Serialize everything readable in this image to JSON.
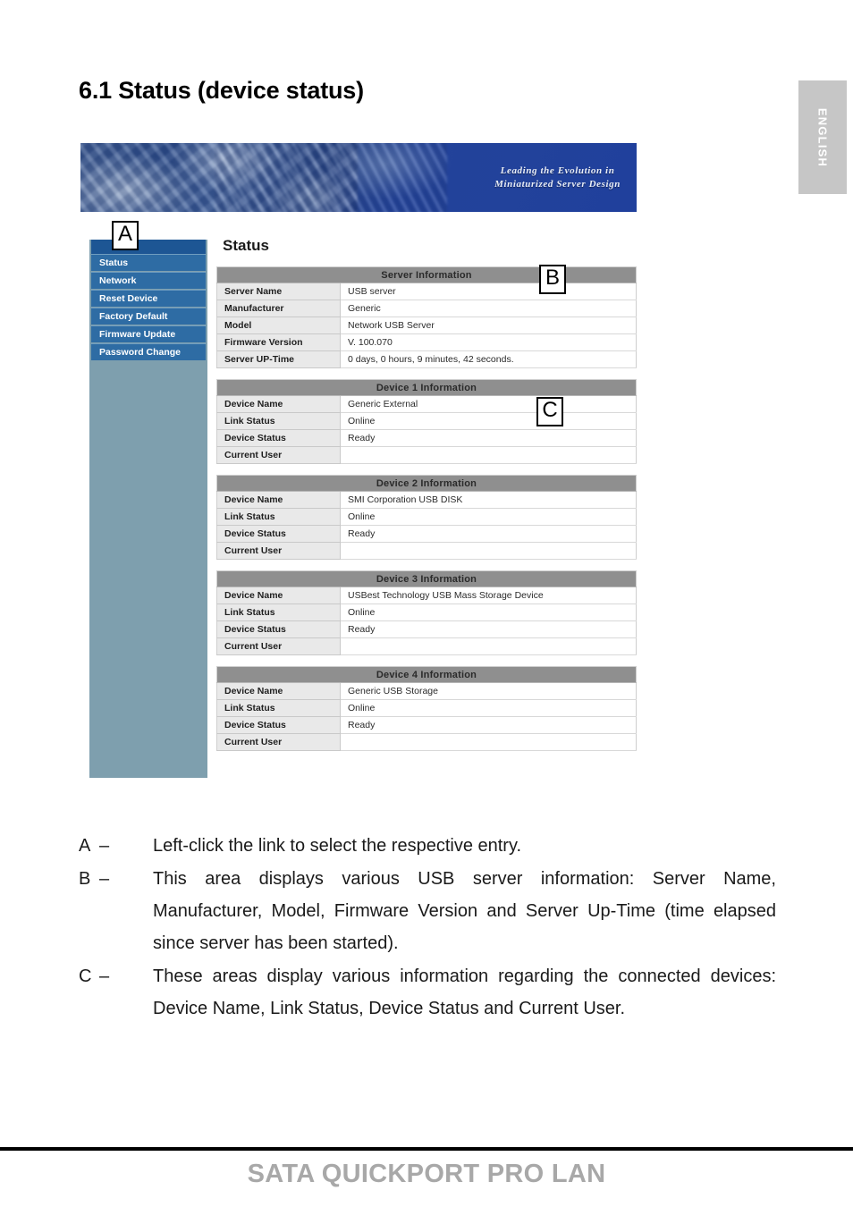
{
  "page": {
    "heading": "6.1 Status (device status)",
    "language_tab": "ENGLISH",
    "footer_title": "SATA QUICKPORT PRO LAN"
  },
  "screenshot": {
    "banner": {
      "tagline_line1": "Leading the Evolution in",
      "tagline_line2": "Miniaturized Server Design"
    },
    "sidebar": {
      "items": [
        {
          "label": "Status"
        },
        {
          "label": "Network"
        },
        {
          "label": "Reset Device"
        },
        {
          "label": "Factory Default"
        },
        {
          "label": "Firmware Update"
        },
        {
          "label": "Password Change"
        }
      ]
    },
    "content": {
      "title": "Status",
      "tables": [
        {
          "header": "Server Information",
          "rows": [
            {
              "label": "Server Name",
              "value": "USB server"
            },
            {
              "label": "Manufacturer",
              "value": "Generic"
            },
            {
              "label": "Model",
              "value": "Network USB Server"
            },
            {
              "label": "Firmware Version",
              "value": "V. 100.070"
            },
            {
              "label": "Server UP-Time",
              "value": "0 days, 0 hours, 9 minutes, 42 seconds."
            }
          ]
        },
        {
          "header": "Device 1 Information",
          "rows": [
            {
              "label": "Device Name",
              "value": "Generic External"
            },
            {
              "label": "Link Status",
              "value": "Online"
            },
            {
              "label": "Device Status",
              "value": "Ready"
            },
            {
              "label": "Current User",
              "value": ""
            }
          ]
        },
        {
          "header": "Device 2 Information",
          "rows": [
            {
              "label": "Device Name",
              "value": "SMI Corporation USB DISK"
            },
            {
              "label": "Link Status",
              "value": "Online"
            },
            {
              "label": "Device Status",
              "value": "Ready"
            },
            {
              "label": "Current User",
              "value": ""
            }
          ]
        },
        {
          "header": "Device 3 Information",
          "rows": [
            {
              "label": "Device Name",
              "value": "USBest Technology USB Mass Storage Device"
            },
            {
              "label": "Link Status",
              "value": "Online"
            },
            {
              "label": "Device Status",
              "value": "Ready"
            },
            {
              "label": "Current User",
              "value": ""
            }
          ]
        },
        {
          "header": "Device 4 Information",
          "rows": [
            {
              "label": "Device Name",
              "value": "Generic USB Storage"
            },
            {
              "label": "Link Status",
              "value": "Online"
            },
            {
              "label": "Device Status",
              "value": "Ready"
            },
            {
              "label": "Current User",
              "value": ""
            }
          ]
        }
      ]
    },
    "callouts": [
      {
        "letter": "A"
      },
      {
        "letter": "B"
      },
      {
        "letter": "C"
      }
    ]
  },
  "legend": [
    {
      "letter": "A",
      "dash": "–",
      "text": "Left-click the link to select the respective entry."
    },
    {
      "letter": "B",
      "dash": "–",
      "text": "This area displays various USB server information: Server Name, Manufacturer, Model, Firmware Version and Server Up-Time (time elapsed since server has been started)."
    },
    {
      "letter": "C",
      "dash": "–",
      "text": "These areas display various information regarding the connected devices: Device Name, Link Status, Device Status and Current User."
    }
  ]
}
